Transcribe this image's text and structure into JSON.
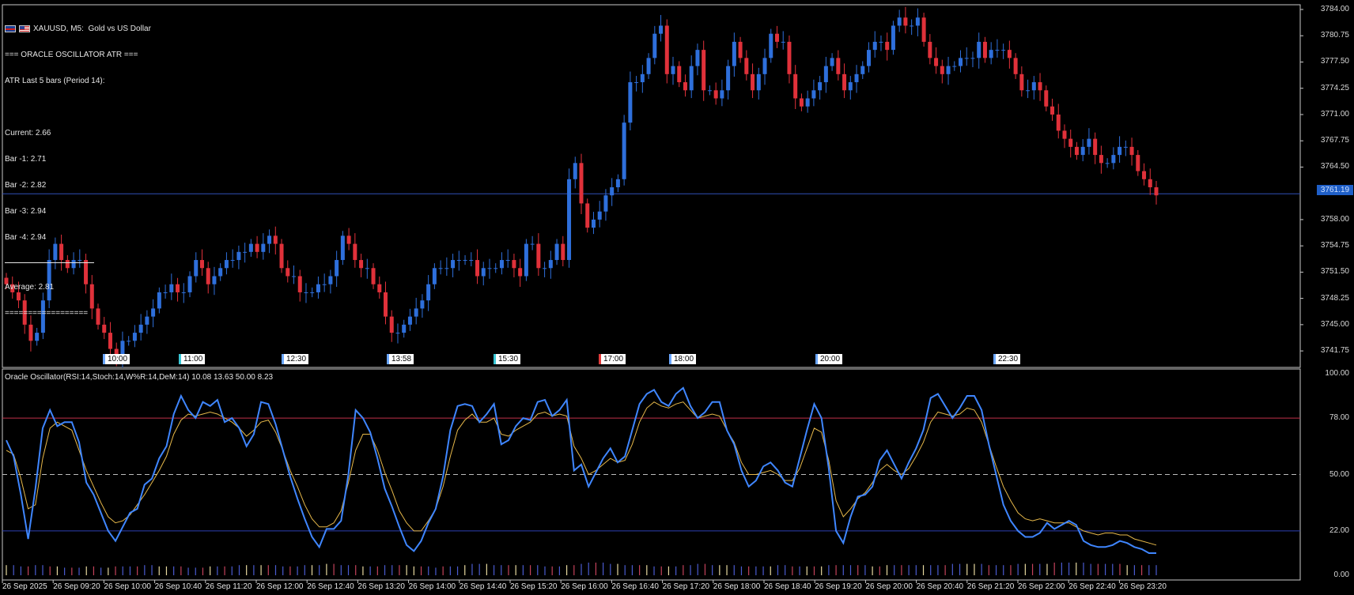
{
  "chart": {
    "symbol_line": "XAUUSD, M5:  Gold vs US Dollar",
    "current_price": "3761.19",
    "price_axis": [
      "3784.00",
      "3780.75",
      "3777.50",
      "3774.25",
      "3771.00",
      "3767.75",
      "3764.50",
      "3758.00",
      "3754.75",
      "3751.50",
      "3748.25",
      "3745.00",
      "3741.75"
    ],
    "time_tags": [
      {
        "label": "10:00",
        "style": "blue"
      },
      {
        "label": "11:00",
        "style": "cyan"
      },
      {
        "label": "12:30",
        "style": "blue"
      },
      {
        "label": "13:58",
        "style": "blue"
      },
      {
        "label": "15:30",
        "style": "cyan"
      },
      {
        "label": "17:00",
        "style": "red"
      },
      {
        "label": "18:00",
        "style": "blue"
      },
      {
        "label": "20:00",
        "style": "blue"
      },
      {
        "label": "22:30",
        "style": "blue"
      }
    ],
    "bullish_color": "#2e6fdb",
    "bearish_color": "#e0313a",
    "ohlc_close": [
      3750,
      3749,
      3748,
      3745,
      3743,
      3744,
      3748,
      3753,
      3755,
      3753,
      3752,
      3753,
      3753,
      3750,
      3747,
      3745,
      3744,
      3742,
      3741,
      3743,
      3743,
      3744,
      3745,
      3746,
      3747,
      3749,
      3749,
      3750,
      3749,
      3749,
      3751,
      3753,
      3752,
      3750,
      3751,
      3752,
      3753,
      3753,
      3754,
      3754,
      3755,
      3754,
      3755,
      3756,
      3755,
      3752,
      3751,
      3751,
      3749,
      3749,
      3749,
      3750,
      3750,
      3751,
      3753,
      3756,
      3755,
      3753,
      3752,
      3752,
      3750,
      3749,
      3746,
      3744,
      3744,
      3745,
      3746,
      3747,
      3748,
      3750,
      3752,
      3752,
      3752,
      3753,
      3753,
      3753,
      3753,
      3751,
      3752,
      3752,
      3752,
      3753,
      3753,
      3752,
      3751,
      3755,
      3755,
      3752,
      3752,
      3753,
      3755,
      3753,
      3763,
      3765,
      3760,
      3757,
      3758,
      3759,
      3761,
      3762,
      3763,
      3770,
      3775,
      3775,
      3776,
      3778,
      3781,
      3782,
      3776,
      3777,
      3775,
      3774,
      3777,
      3779,
      3774,
      3774,
      3773,
      3774,
      3777,
      3780,
      3778,
      3776,
      3774,
      3776,
      3778,
      3781,
      3780,
      3780,
      3776,
      3773,
      3772,
      3773,
      3774,
      3775,
      3777,
      3778,
      3776,
      3774,
      3775,
      3776,
      3777,
      3779,
      3780,
      3780,
      3779,
      3782,
      3783,
      3782,
      3782,
      3783,
      3780,
      3778,
      3777,
      3776,
      3777,
      3777,
      3778,
      3778,
      3778,
      3780,
      3778,
      3779,
      3779,
      3779,
      3778,
      3776,
      3774,
      3774,
      3775,
      3774,
      3772,
      3771,
      3769,
      3768,
      3767,
      3766,
      3767,
      3768,
      3766,
      3765,
      3765,
      3766,
      3767,
      3767,
      3766,
      3764,
      3763,
      3762,
      3761
    ]
  },
  "atr_panel": {
    "header": "=== ORACLE OSCILLATOR ATR ===",
    "subtitle": "ATR Last 5 bars (Period 14):",
    "current": "Current: 2.66",
    "bar1": "Bar -1: 2.71",
    "bar2": "Bar -2: 2.82",
    "bar3": "Bar -3: 2.94",
    "bar4": "Bar -4: 2.94",
    "average": "Average: 2.81",
    "footer": "=================="
  },
  "oscillator": {
    "label": "Oracle Oscillator(RSI:14,Stoch:14,W%R:14,DeM:14) 10.08 13.63 50.00 8.23",
    "levels": [
      "100.00",
      "78.00",
      "50.00",
      "22.00",
      "0.00"
    ],
    "main_color": "#3f86ff",
    "signal_color": "#e6b84a",
    "main_values": [
      67,
      59,
      40,
      18,
      43,
      73,
      82,
      74,
      76,
      76,
      66,
      46,
      40,
      31,
      22,
      17,
      24,
      31,
      33,
      45,
      48,
      58,
      64,
      80,
      89,
      82,
      78,
      86,
      84,
      87,
      76,
      78,
      73,
      64,
      70,
      86,
      85,
      75,
      62,
      49,
      38,
      28,
      19,
      14,
      23,
      23,
      27,
      50,
      82,
      78,
      71,
      58,
      43,
      34,
      24,
      15,
      12,
      17,
      26,
      33,
      49,
      72,
      84,
      85,
      84,
      76,
      80,
      85,
      65,
      67,
      74,
      78,
      77,
      86,
      87,
      79,
      82,
      87,
      52,
      55,
      44,
      51,
      58,
      63,
      56,
      59,
      72,
      85,
      90,
      92,
      86,
      84,
      90,
      93,
      84,
      78,
      81,
      86,
      86,
      72,
      65,
      52,
      44,
      47,
      54,
      56,
      52,
      46,
      44,
      58,
      72,
      85,
      78,
      53,
      22,
      16,
      29,
      39,
      40,
      44,
      57,
      62,
      55,
      48,
      56,
      63,
      72,
      88,
      90,
      84,
      78,
      83,
      89,
      89,
      82,
      65,
      50,
      35,
      27,
      22,
      19,
      19,
      21,
      26,
      23,
      25,
      27,
      25,
      17,
      15,
      14,
      14,
      15,
      17,
      16,
      14,
      13,
      11,
      11
    ],
    "signal_values": [
      62,
      60,
      48,
      33,
      35,
      58,
      73,
      76,
      74,
      72,
      62,
      52,
      44,
      36,
      29,
      26,
      27,
      30,
      35,
      40,
      46,
      52,
      59,
      70,
      77,
      80,
      79,
      80,
      81,
      80,
      78,
      76,
      73,
      69,
      72,
      76,
      77,
      71,
      62,
      52,
      44,
      35,
      28,
      24,
      24,
      26,
      32,
      46,
      62,
      70,
      70,
      62,
      51,
      42,
      32,
      26,
      22,
      22,
      27,
      33,
      44,
      59,
      72,
      77,
      80,
      76,
      76,
      78,
      70,
      69,
      72,
      74,
      76,
      80,
      81,
      79,
      80,
      79,
      64,
      58,
      50,
      52,
      55,
      58,
      56,
      57,
      65,
      76,
      83,
      86,
      84,
      83,
      85,
      86,
      82,
      78,
      79,
      80,
      79,
      72,
      66,
      56,
      50,
      50,
      51,
      52,
      50,
      47,
      47,
      53,
      63,
      73,
      71,
      57,
      37,
      29,
      33,
      38,
      41,
      46,
      52,
      55,
      52,
      50,
      53,
      59,
      66,
      76,
      81,
      80,
      79,
      80,
      83,
      82,
      76,
      65,
      54,
      44,
      37,
      31,
      28,
      27,
      28,
      27,
      26,
      26,
      26,
      24,
      22,
      21,
      20,
      21,
      21,
      20,
      20,
      18,
      17,
      16,
      15
    ],
    "bar_values": [
      8,
      8,
      7,
      7,
      8,
      8,
      7,
      7,
      6,
      6,
      6,
      7,
      7,
      6,
      6,
      7,
      7,
      7,
      7,
      8,
      8,
      7,
      7,
      7,
      7,
      6,
      6,
      6,
      7,
      7,
      7,
      7,
      8,
      8,
      8,
      8,
      8,
      8,
      7,
      7,
      7,
      8,
      8,
      8,
      9,
      9,
      8,
      8,
      8,
      7,
      7,
      7,
      8,
      8,
      8,
      8,
      7,
      7,
      7,
      6,
      7,
      7,
      7,
      8,
      9,
      9,
      9,
      8,
      8,
      8,
      8,
      8,
      8,
      8,
      7,
      7,
      7,
      8,
      8,
      9,
      10,
      10,
      10,
      9,
      9,
      8,
      8,
      8,
      8,
      7,
      7,
      7,
      7,
      8,
      8,
      9,
      9,
      8,
      8,
      8,
      8,
      7,
      7,
      7,
      7,
      7,
      8,
      8,
      7,
      7,
      7,
      7,
      7,
      8,
      8,
      8,
      8,
      8,
      8,
      7,
      7,
      8,
      8,
      8,
      8,
      8,
      8,
      8,
      8,
      8,
      9,
      9,
      9,
      9,
      9,
      8,
      8,
      8,
      8,
      9,
      9,
      9,
      9,
      9,
      10,
      10,
      10,
      10,
      10,
      9,
      9,
      9,
      9,
      9,
      8,
      8,
      8,
      8,
      8
    ]
  },
  "time_axis": [
    "26 Sep 2025",
    "26 Sep 09:20",
    "26 Sep 10:00",
    "26 Sep 10:40",
    "26 Sep 11:20",
    "26 Sep 12:00",
    "26 Sep 12:40",
    "26 Sep 13:20",
    "26 Sep 14:00",
    "26 Sep 14:40",
    "26 Sep 15:20",
    "26 Sep 16:00",
    "26 Sep 16:40",
    "26 Sep 17:20",
    "26 Sep 18:00",
    "26 Sep 18:40",
    "26 Sep 19:20",
    "26 Sep 20:00",
    "26 Sep 20:40",
    "26 Sep 21:20",
    "26 Sep 22:00",
    "26 Sep 22:40",
    "26 Sep 23:20"
  ]
}
